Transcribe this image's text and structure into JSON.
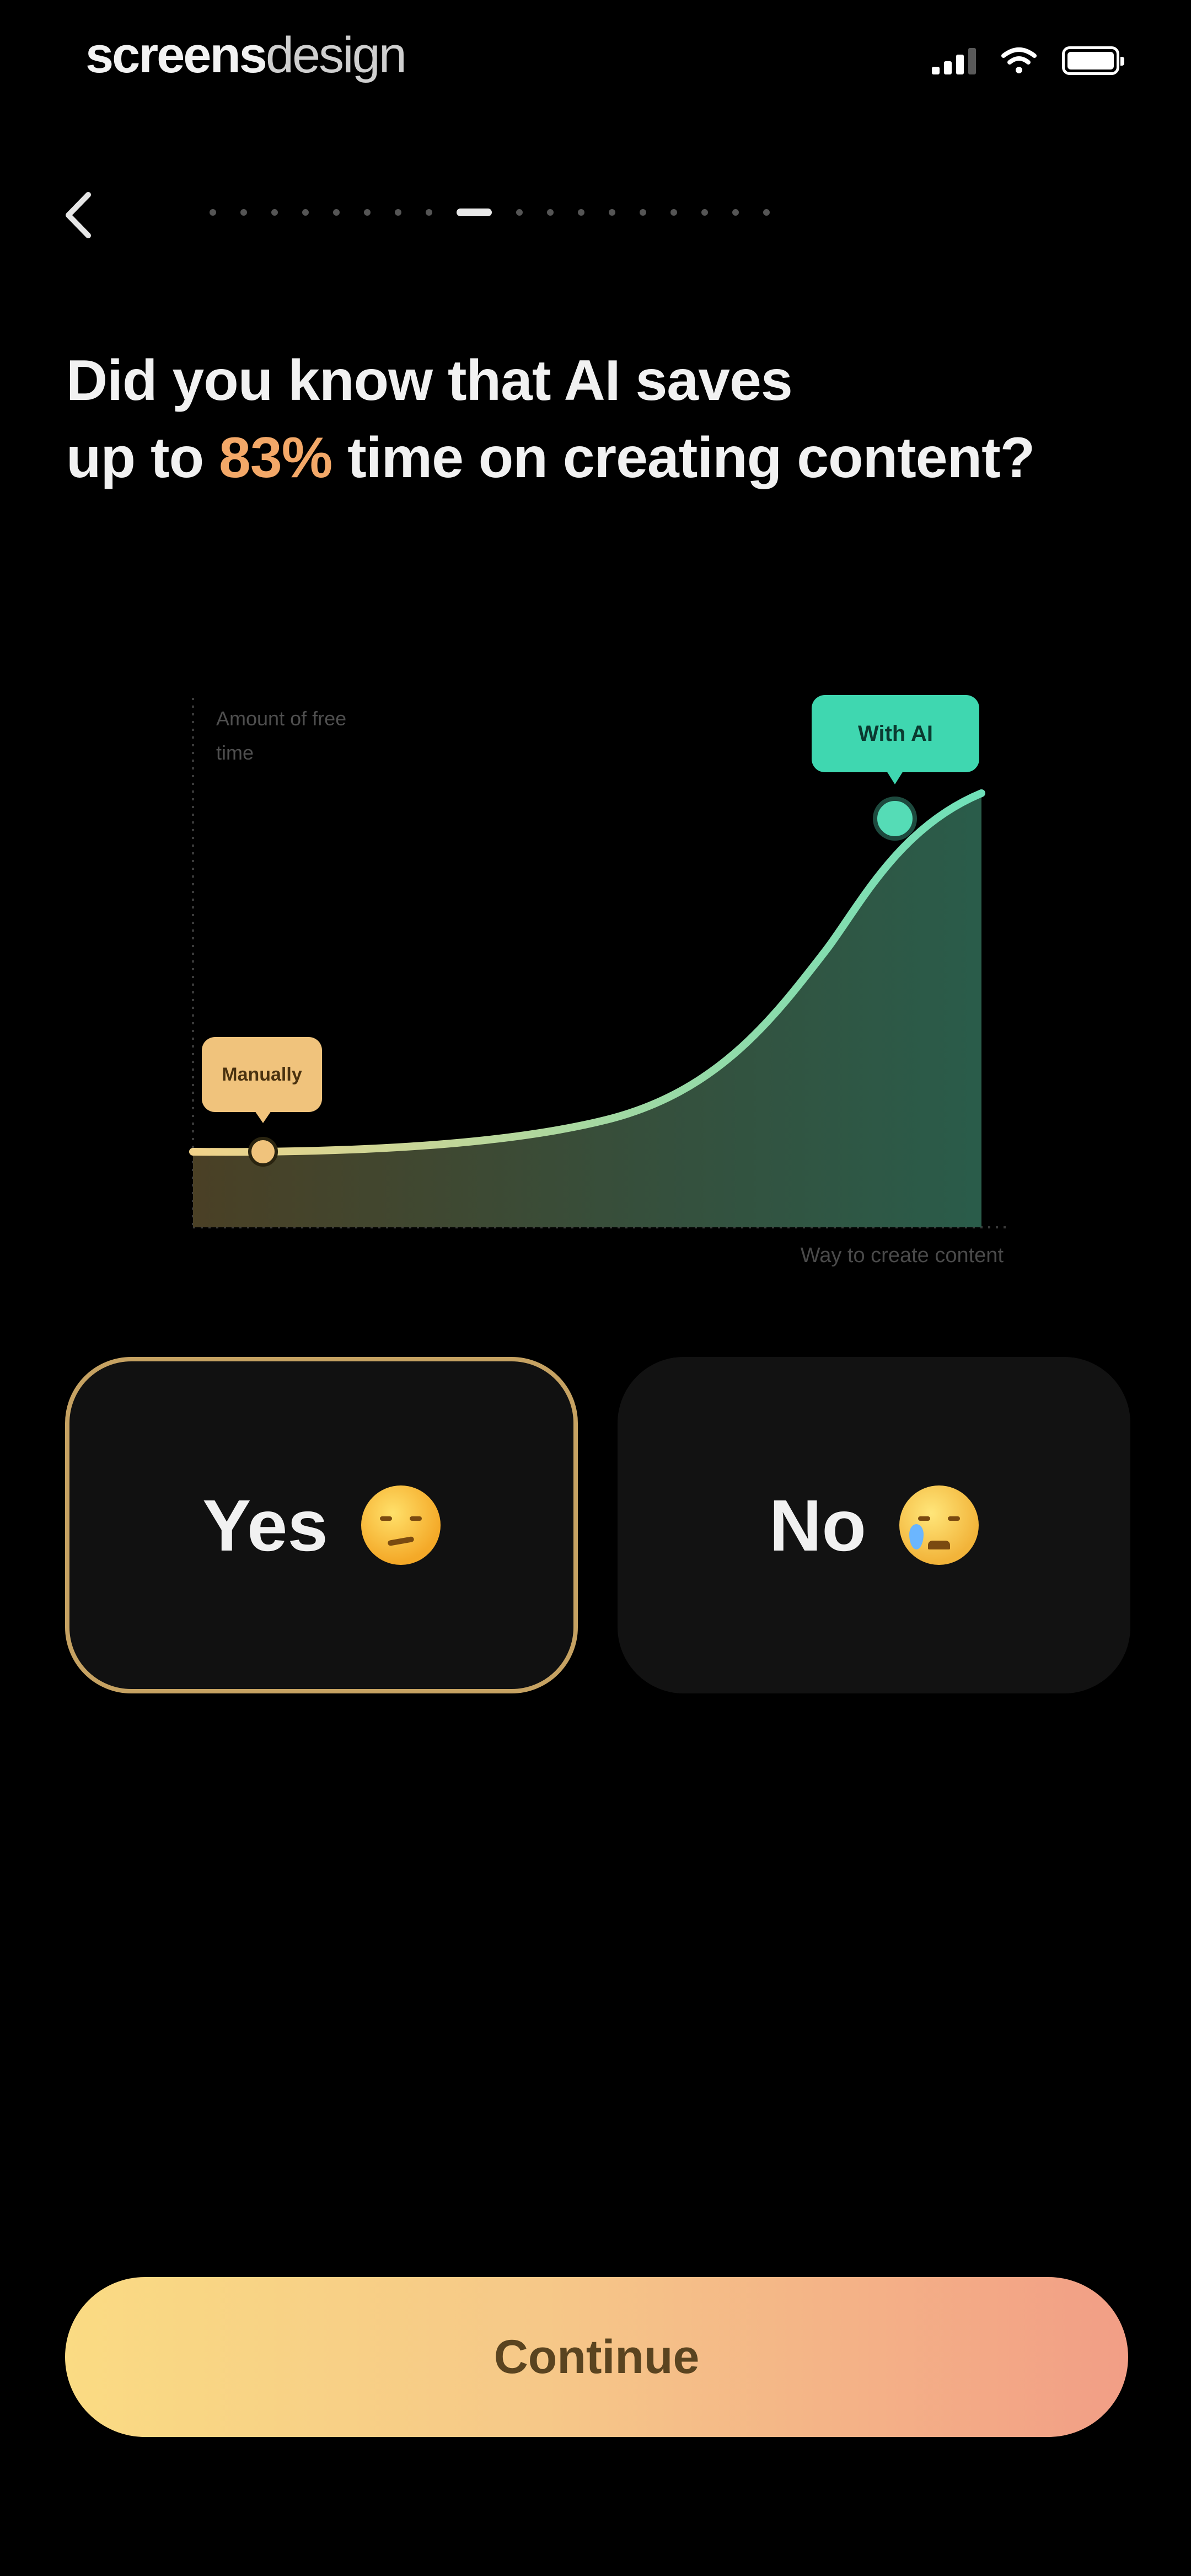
{
  "status_bar": {
    "brand_bold": "screens",
    "brand_light": "design"
  },
  "nav": {
    "back_icon": "chevron-left-icon",
    "progress_total": 18,
    "progress_current": 9
  },
  "headline": {
    "line1": "Did you know that AI saves",
    "line2_prefix": "up to ",
    "accent": "83%",
    "line2_suffix": " time on creating content?"
  },
  "chart": {
    "ylabel": "Amount of free time",
    "xlabel": "Way to create content",
    "tag_ai": "With AI",
    "tag_manual": "Manually"
  },
  "options": [
    {
      "label": "Yes",
      "emoji": "smirk-emoji-icon",
      "selected": true
    },
    {
      "label": "No",
      "emoji": "crying-emoji-icon",
      "selected": false
    }
  ],
  "continue_label": "Continue",
  "colors": {
    "accent_orange": "#f3a868",
    "chart_green": "#3fd7b0",
    "tag_manual": "#f0c37c",
    "selected_border": "#c6a262"
  }
}
